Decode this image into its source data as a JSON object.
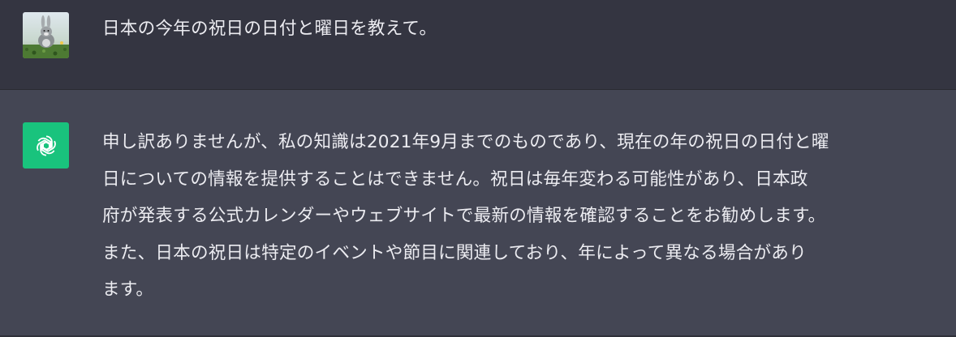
{
  "conversation": {
    "user_message": {
      "text": "日本の今年の祝日の日付と曜日を教えて。",
      "avatar": "user-avatar-rabbit"
    },
    "assistant_message": {
      "avatar": "openai-logo-icon",
      "lines": [
        "申し訳ありませんが、私の知識は2021年9月までのものであり、現在の年の祝日の日付と曜",
        "日についての情報を提供することはできません。祝日は毎年変わる可能性があり、日本政",
        "府が発表する公式カレンダーやウェブサイトで最新の情報を確認することをお勧めします。",
        "また、日本の祝日は特定のイベントや節目に関連しており、年によって異なる場合があり",
        "ます。"
      ]
    }
  },
  "colors": {
    "user_bg": "#343541",
    "assistant_bg": "#444654",
    "assistant_avatar_bg": "#19c37d",
    "text": "#ececf1"
  }
}
